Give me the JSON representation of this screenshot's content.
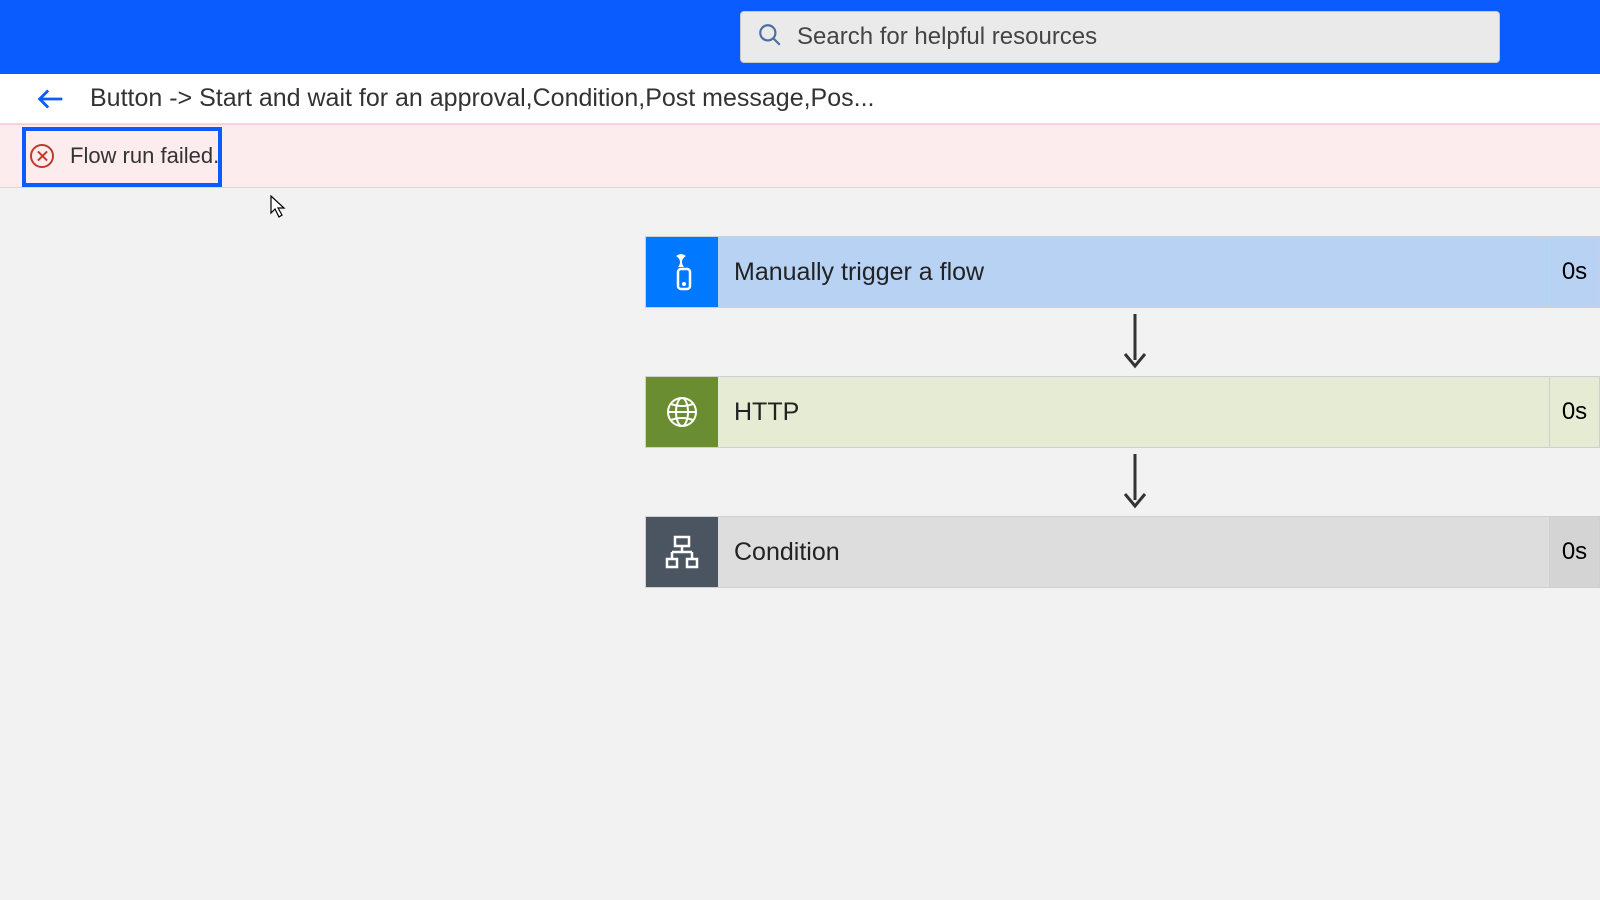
{
  "header": {
    "search_placeholder": "Search for helpful resources"
  },
  "breadcrumb": {
    "title": "Button -> Start and wait for an approval,Condition,Post message,Pos..."
  },
  "error": {
    "message": "Flow run failed."
  },
  "flow": {
    "steps": [
      {
        "label": "Manually trigger a flow",
        "duration": "0s"
      },
      {
        "label": "HTTP",
        "duration": "0s"
      },
      {
        "label": "Condition",
        "duration": "0s"
      }
    ]
  },
  "colors": {
    "brand": "#0a5cff",
    "trigger": "#0078ff",
    "http": "#6a8d31",
    "condition": "#4b5562",
    "error": "#c0392b"
  }
}
